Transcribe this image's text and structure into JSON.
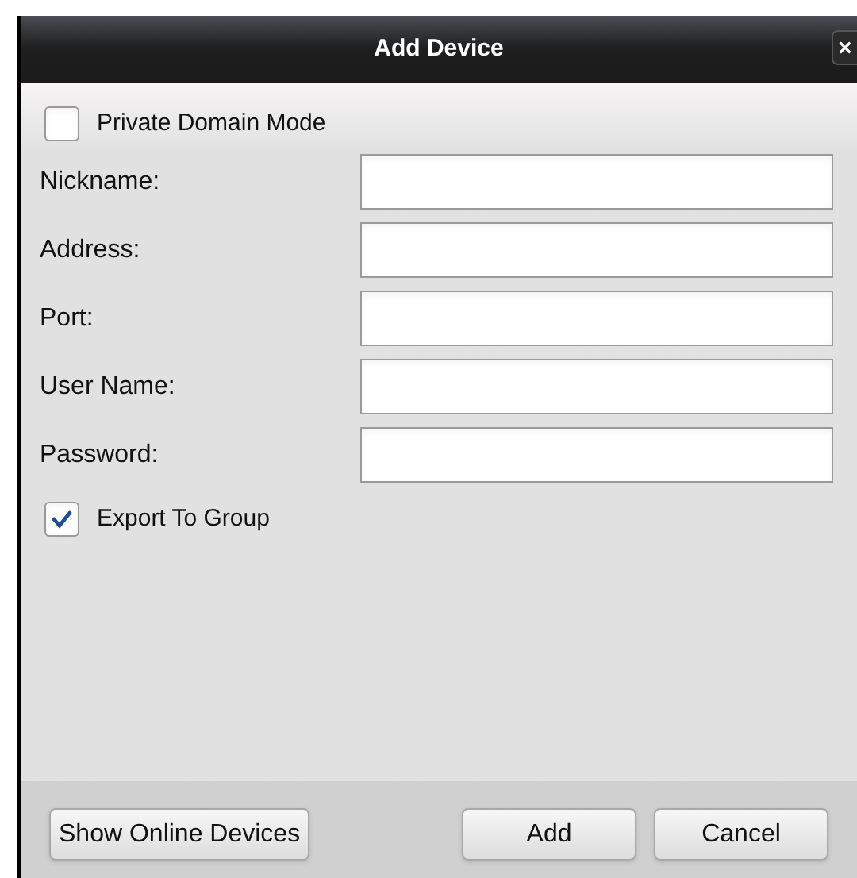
{
  "window": {
    "title": "Add Device",
    "close": "×"
  },
  "private_domain_mode": {
    "label": "Private Domain Mode",
    "checked": false
  },
  "fields": [
    {
      "label": "Nickname:"
    },
    {
      "label": "Address:"
    },
    {
      "label": "Port:"
    },
    {
      "label": "User Name:"
    },
    {
      "label": "Password:"
    }
  ],
  "export_to_group": {
    "label": "Export To Group",
    "checked": true
  },
  "buttons": [
    {
      "label": "Show Online Devices",
      "kind": "left"
    },
    {
      "label": "Add",
      "kind": "right"
    },
    {
      "label": "Cancel",
      "kind": "right"
    }
  ]
}
